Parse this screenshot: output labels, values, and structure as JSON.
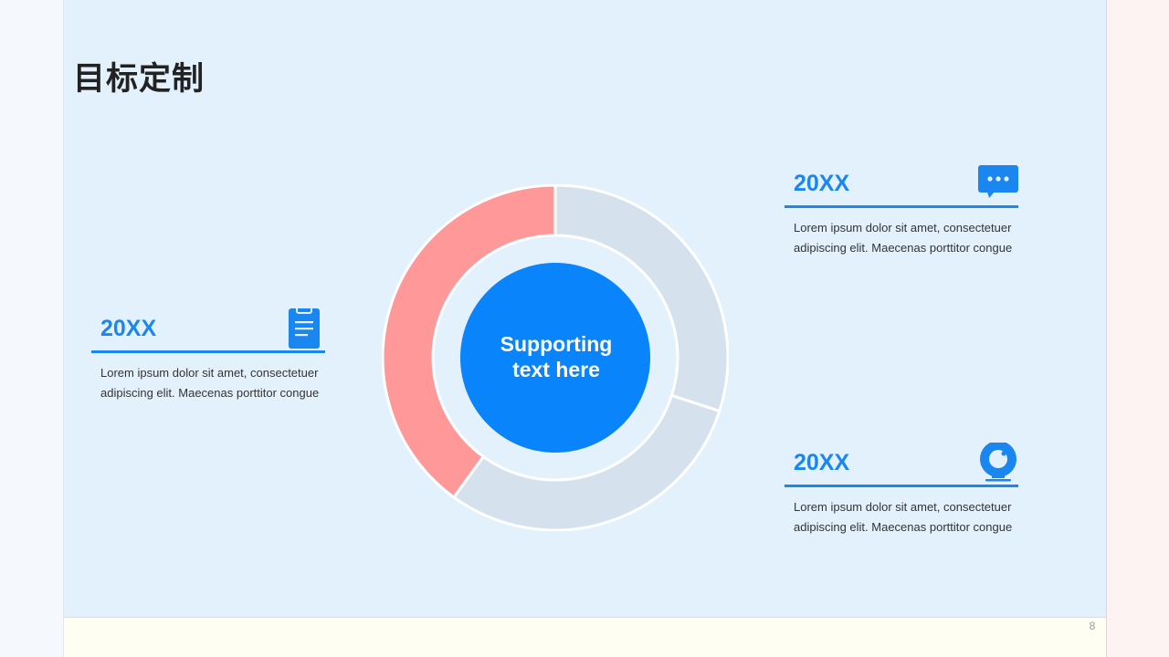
{
  "slide": {
    "title": "目标定制",
    "page_number": "8"
  },
  "blocks": [
    {
      "year": "20XX",
      "icon": "clipboard-icon",
      "desc_line1": "Lorem ipsum dolor sit amet, consectetuer",
      "desc_line2": "adipiscing elit. Maecenas porttitor congue"
    },
    {
      "year": "20XX",
      "icon": "chat-bubble-icon",
      "desc_line1": "Lorem ipsum dolor sit amet, consectetuer",
      "desc_line2": "adipiscing elit. Maecenas porttitor congue"
    },
    {
      "year": "20XX",
      "icon": "webcam-icon",
      "desc_line1": "Lorem ipsum dolor sit amet, consectetuer",
      "desc_line2": "adipiscing elit. Maecenas porttitor congue"
    }
  ],
  "chart_data": {
    "type": "pie",
    "donut": true,
    "values": [
      30,
      30,
      40
    ],
    "colors": [
      "#d5e2ee",
      "#d5e2ee",
      "#ff9999"
    ],
    "center_label_line1": "Supporting",
    "center_label_line2": "text here",
    "center_color": "#0a84fa"
  },
  "colors": {
    "accent": "#1a86f0",
    "highlight": "#ff9999",
    "track": "#d5e2ee"
  }
}
